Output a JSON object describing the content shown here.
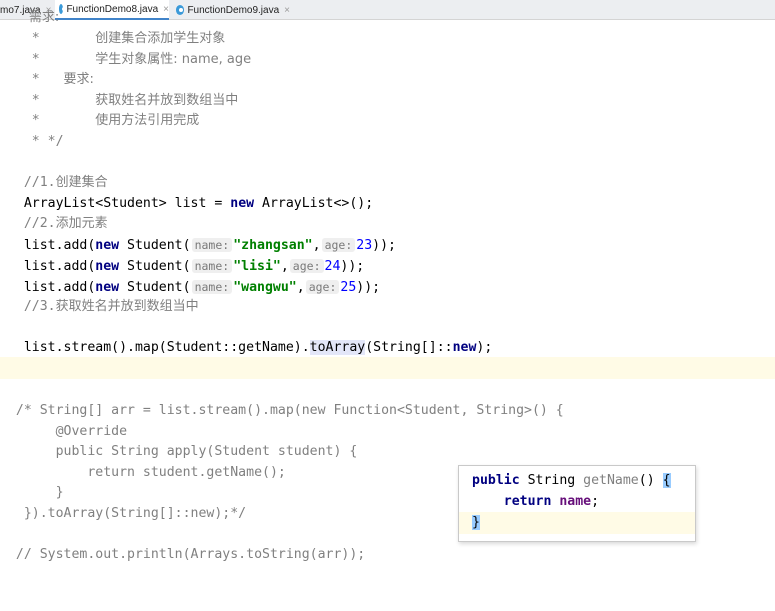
{
  "tabs": [
    {
      "label": "mo7.java",
      "close": "×"
    },
    {
      "label": "FunctionDemo8.java",
      "close": "×"
    },
    {
      "label": "FunctionDemo9.java",
      "close": "×"
    }
  ],
  "code": {
    "c0": "       需求:",
    "c1a": "    *       ",
    "c1b": "创建集合添加学生对象",
    "c2a": "    *       ",
    "c2b": "学生对象属性: name, age",
    "c3a": "    *   ",
    "c3b": "要求:",
    "c4a": "    *       ",
    "c4b": "获取姓名并放到数组当中",
    "c5a": "    *       ",
    "c5b": "使用方法引用完成",
    "c6": "    * */",
    "m1a": "   //1.",
    "m1b": "创建集合",
    "l1a": "   ArrayList<Student> list = ",
    "l1kw": "new",
    "l1b": " ArrayList<>();",
    "m2a": "   //2.",
    "m2b": "添加元素",
    "add_prefix": "   list.add(",
    "kw_new": "new",
    "student_open": " Student(",
    "hint_name": "name:",
    "hint_age": "age:",
    "s1": "\"zhangsan\"",
    "a1": "23",
    "s2": "\"lisi\"",
    "a2": "24",
    "s3": "\"wangwu\"",
    "a3": "25",
    "comma": ",",
    "close_paren": "));",
    "m3a": "   //3.",
    "m3b": "获取姓名并放到数组当中",
    "st1": "   list.stream().map(Student::getName).",
    "st_hl": "toArray",
    "st2": "(String[]::",
    "st_kw": "new",
    "st3": ");",
    "b1": "  /* String[] arr = list.stream().map(new Function<Student, String>() {",
    "b2": "       @Override",
    "b3": "       public String apply(Student student) {",
    "b4": "           return student.getName();",
    "b5": "       }",
    "b6": "   }).toArray(String[]::new);*/",
    "b7": "  // System.out.println(Arrays.toString(arr));"
  },
  "popup": {
    "l1_kw": "public",
    "l1_type": " String ",
    "l1_name": "getName",
    "l1_rest": "() ",
    "l1_brace": "{",
    "l2_kw": "return",
    "l2_field": " name",
    "l2_rest": ";",
    "l3_brace": "}"
  }
}
